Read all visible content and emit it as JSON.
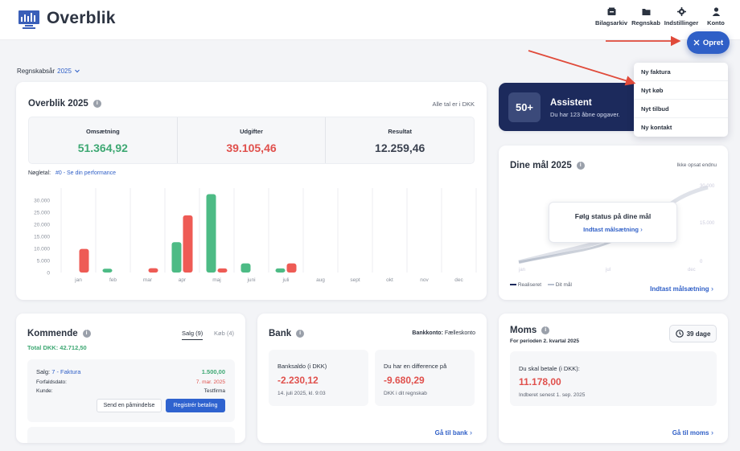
{
  "app": {
    "title": "Overblik"
  },
  "nav": [
    {
      "label": "Bilagsarkiv",
      "icon": "archive-icon"
    },
    {
      "label": "Regnskab",
      "icon": "folder-icon"
    },
    {
      "label": "Indstillinger",
      "icon": "gear-icon"
    },
    {
      "label": "Konto",
      "icon": "user-icon"
    }
  ],
  "opret": {
    "label": "Opret",
    "icon": "close-icon"
  },
  "year_selector": {
    "label": "Regnskabsår",
    "value": "2025"
  },
  "menu": {
    "items": [
      "Ny faktura",
      "Nyt køb",
      "Nyt tilbud",
      "Ny kontakt"
    ]
  },
  "overview": {
    "title": "Overblik 2025",
    "note": "Alle tal er i DKK",
    "kpis": [
      {
        "label": "Omsætning",
        "value": "51.364,92",
        "color": "#3ea873"
      },
      {
        "label": "Udgifter",
        "value": "39.105,46",
        "color": "#e0504c"
      },
      {
        "label": "Resultat",
        "value": "12.259,46",
        "color": "#3b4250"
      }
    ],
    "noegletal_label": "Nøgletal:",
    "noegletal_link": "#0 - Se din performance"
  },
  "chart_data": {
    "type": "bar",
    "categories": [
      "jan",
      "feb",
      "mar",
      "apr",
      "maj",
      "juni",
      "juli",
      "aug",
      "sept",
      "okt",
      "nov",
      "dec"
    ],
    "y_ticks": [
      "30.000",
      "25.000",
      "20.000",
      "15.000",
      "10.000",
      "5.000",
      "0"
    ],
    "ylim": [
      0,
      35000
    ],
    "series": [
      {
        "color": "#4dbb85",
        "values": [
          0,
          1600,
          0,
          12600,
          32500,
          3800,
          1700,
          0,
          0,
          0,
          0,
          0
        ]
      },
      {
        "color": "#ee5b55",
        "values": [
          9800,
          0,
          1800,
          23700,
          1700,
          0,
          3800,
          0,
          0,
          0,
          0,
          0
        ]
      }
    ]
  },
  "assistant": {
    "count": "50+",
    "title": "Assistent",
    "subtitle": "Du har 123 åbne opgaver."
  },
  "goals": {
    "title": "Dine mål 2025",
    "status": "Ikke opsat endnu",
    "overlay_title": "Følg status på dine mål",
    "overlay_link": "Indtast målsætning",
    "legend": [
      "Realiseret",
      "Dit mål"
    ],
    "link": "Indtast målsætning",
    "bg_ticks": [
      "30.000",
      "15.000",
      "0"
    ],
    "bg_months": [
      "jan",
      "jul",
      "dec"
    ]
  },
  "kommende": {
    "title": "Kommende",
    "tabs": [
      "Salg (9)",
      "Køb (4)"
    ],
    "total_label": "Total DKK:",
    "total_value": "42.712,50",
    "item": {
      "label": "Salg:",
      "link": "7 - Faktura",
      "amount": "1.500,00",
      "due_label": "Forfaldsdato:",
      "due_value": "7. mar. 2025",
      "customer_label": "Kunde:",
      "customer_value": "Testfirma",
      "btn_remind": "Send en påmindelse",
      "btn_register": "Registrér betaling"
    }
  },
  "bank": {
    "title": "Bank",
    "account_label": "Bankkonto:",
    "account_value": "Fælleskonto",
    "saldo_label": "Banksaldo (i DKK)",
    "saldo_value": "-2.230,12",
    "saldo_date": "14. juli 2025, kl. 9:03",
    "diff_label": "Du har en difference på",
    "diff_value": "-9.680,29",
    "diff_note": "DKK i dit regnskab",
    "link": "Gå til bank"
  },
  "moms": {
    "title": "Moms",
    "days": "39 dage",
    "period": "For perioden 2. kvartal 2025",
    "pay_label": "Du skal betale (i DKK):",
    "pay_value": "11.178,00",
    "deadline": "Indberet senest 1. sep. 2025",
    "link": "Gå til moms"
  },
  "colors": {
    "accent": "#2f5fc7",
    "navy": "#1c2a5c",
    "green": "#4dbb85",
    "red": "#ee5b55"
  }
}
